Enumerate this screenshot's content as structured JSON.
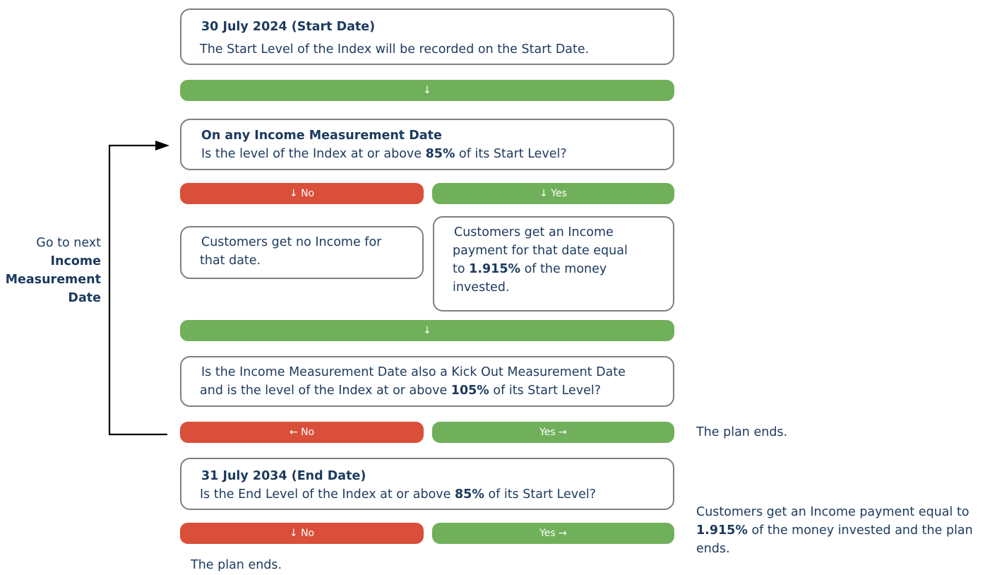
{
  "start": {
    "heading": "30 July 2024 (Start Date)",
    "text": "The Start Level of the Index will be recorded on the Start Date."
  },
  "arrow_down": "↓",
  "income_check": {
    "heading": "On any Income Measurement Date",
    "pre": "Is the level of the Index at or above ",
    "pct": "85%",
    "post": " of its Start Level?"
  },
  "branch1": {
    "no": "↓ No",
    "yes": "↓ Yes"
  },
  "no_income": {
    "line1": "Customers get no Income for",
    "line2": "that date."
  },
  "income": {
    "line1": "Customers get an Income",
    "line2": "payment for that date equal",
    "line3_pre": "to ",
    "pct": "1.915%",
    "line3_post": " of the money",
    "line4": "invested."
  },
  "kickout": {
    "line1": "Is the Income Measurement Date also a Kick Out Measurement Date",
    "line2_pre": "and is the level of the Index at or above ",
    "pct": "105%",
    "line2_post": " of its Start Level?"
  },
  "branch2": {
    "no": "← No",
    "yes": "Yes →"
  },
  "plan_ends_kickout": "The plan ends.",
  "goto_next": {
    "line1": "Go to next",
    "line2": "Income",
    "line3": "Measurement",
    "line4": "Date"
  },
  "end": {
    "heading": "31 July 2034  (End Date)",
    "pre": "Is the End Level of the Index at or above ",
    "pct": "85%",
    "post": " of its Start Level?"
  },
  "branch3": {
    "no": "↓ No",
    "yes": "Yes →"
  },
  "final_income": {
    "line1": "Customers get an Income payment equal to",
    "pct": "1.915%",
    "line2_post": " of the money invested and the plan",
    "line3": "ends."
  },
  "plan_ends_final": "The plan ends.",
  "colors": {
    "text": "#1c3a5e",
    "green": "#70b05a",
    "red": "#d94f3a",
    "border": "#7f7f7f"
  }
}
